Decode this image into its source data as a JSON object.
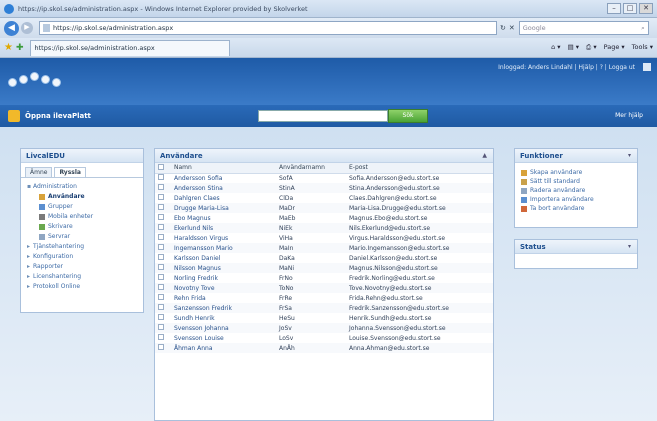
{
  "window": {
    "title": "https://ip.skol.se/administration.aspx - Windows Internet Explorer provided by Skolverket",
    "minimize": "–",
    "maximize": "□",
    "close": "✕"
  },
  "addressbar": {
    "back_label": "◀",
    "forward_label": "▶",
    "url": "https://ip.skol.se/administration.aspx",
    "refresh": "↻",
    "stop": "✕",
    "search_placeholder": "Google",
    "search_icon": "⌕"
  },
  "tabbar": {
    "tab_title": "https://ip.skol.se/administration.aspx",
    "home": "⌂ ▾",
    "feeds": "▤ ▾",
    "print": "⎙ ▾",
    "page": "Page ▾",
    "tools": "Tools ▾"
  },
  "header": {
    "user_info": "Inloggad: Anders Lindahl | Hjälp | ? | Logga ut",
    "app_name": "Öppna ilevaPlatt",
    "search_button": "Sök",
    "help_link": "Mer hjälp"
  },
  "left_panel": {
    "title": "LivcalEDU",
    "tabs": [
      "Ämne",
      "Ryssla"
    ],
    "tree": [
      {
        "label": "Administration",
        "level": 0
      },
      {
        "label": "Användare",
        "level": 1,
        "active": true
      },
      {
        "label": "Grupper",
        "level": 1
      },
      {
        "label": "Mobila enheter",
        "level": 1
      },
      {
        "label": "Skrivare",
        "level": 1
      },
      {
        "label": "Servrar",
        "level": 1
      },
      {
        "label": "Tjänstehantering",
        "level": 0
      },
      {
        "label": "Konfiguration",
        "level": 0
      },
      {
        "label": "Rapporter",
        "level": 0
      },
      {
        "label": "Licenshantering",
        "level": 0
      },
      {
        "label": "Protokoll Online",
        "level": 0
      }
    ]
  },
  "main_panel": {
    "title": "Användare",
    "collapse": "▲",
    "columns": [
      "Namn",
      "Användarnamn",
      "E-post"
    ],
    "rows": [
      [
        "Andersson Sofia",
        "SofA",
        "Sofia.Andersson@edu.stort.se"
      ],
      [
        "Andersson Stina",
        "StinA",
        "Stina.Andersson@edu.stort.se"
      ],
      [
        "Dahlgren Claes",
        "ClDa",
        "Claes.Dahlgren@edu.stort.se"
      ],
      [
        "Drugge Maria-Lisa",
        "MaDr",
        "Maria-Lisa.Drugge@edu.stort.se"
      ],
      [
        "Ebo Magnus",
        "MaEb",
        "Magnus.Ebo@edu.stort.se"
      ],
      [
        "Ekerlund Nils",
        "NiEk",
        "Nils.Ekerlund@edu.stort.se"
      ],
      [
        "Haraldsson Virgus",
        "ViHa",
        "Virgus.Haraldsson@edu.stort.se"
      ],
      [
        "Ingemansson Mario",
        "MaIn",
        "Mario.Ingemansson@edu.stort.se"
      ],
      [
        "Karlsson Daniel",
        "DaKa",
        "Daniel.Karlsson@edu.stort.se"
      ],
      [
        "Nilsson Magnus",
        "MaNi",
        "Magnus.Nilsson@edu.stort.se"
      ],
      [
        "Norling Fredrik",
        "FrNo",
        "Fredrik.Norling@edu.stort.se"
      ],
      [
        "Novotny Tove",
        "ToNo",
        "Tove.Novotny@edu.stort.se"
      ],
      [
        "Rehn Frida",
        "FrRe",
        "Frida.Rehn@edu.stort.se"
      ],
      [
        "Sanzensson Fredrik",
        "FrSa",
        "Fredrik.Sanzensson@edu.stort.se"
      ],
      [
        "Sundh Henrik",
        "HeSu",
        "Henrik.Sundh@edu.stort.se"
      ],
      [
        "Svensson Johanna",
        "JoSv",
        "Johanna.Svensson@edu.stort.se"
      ],
      [
        "Svensson Louise",
        "LoSv",
        "Louise.Svensson@edu.stort.se"
      ],
      [
        "Åhman Anna",
        "AnÅh",
        "Anna.Ahman@edu.stort.se"
      ]
    ]
  },
  "right_panels": {
    "functions_title": "Funktioner",
    "functions_caret": "▾",
    "actions": [
      "Skapa användare",
      "Sätt till standard",
      "Radera användare",
      "Importera användare",
      "Ta bort användare"
    ],
    "status_title": "Status",
    "status_caret": "▾"
  },
  "colors": {
    "header_blue": "#1e5ba8",
    "search_green": "#4aa335",
    "link_blue": "#27508a"
  }
}
